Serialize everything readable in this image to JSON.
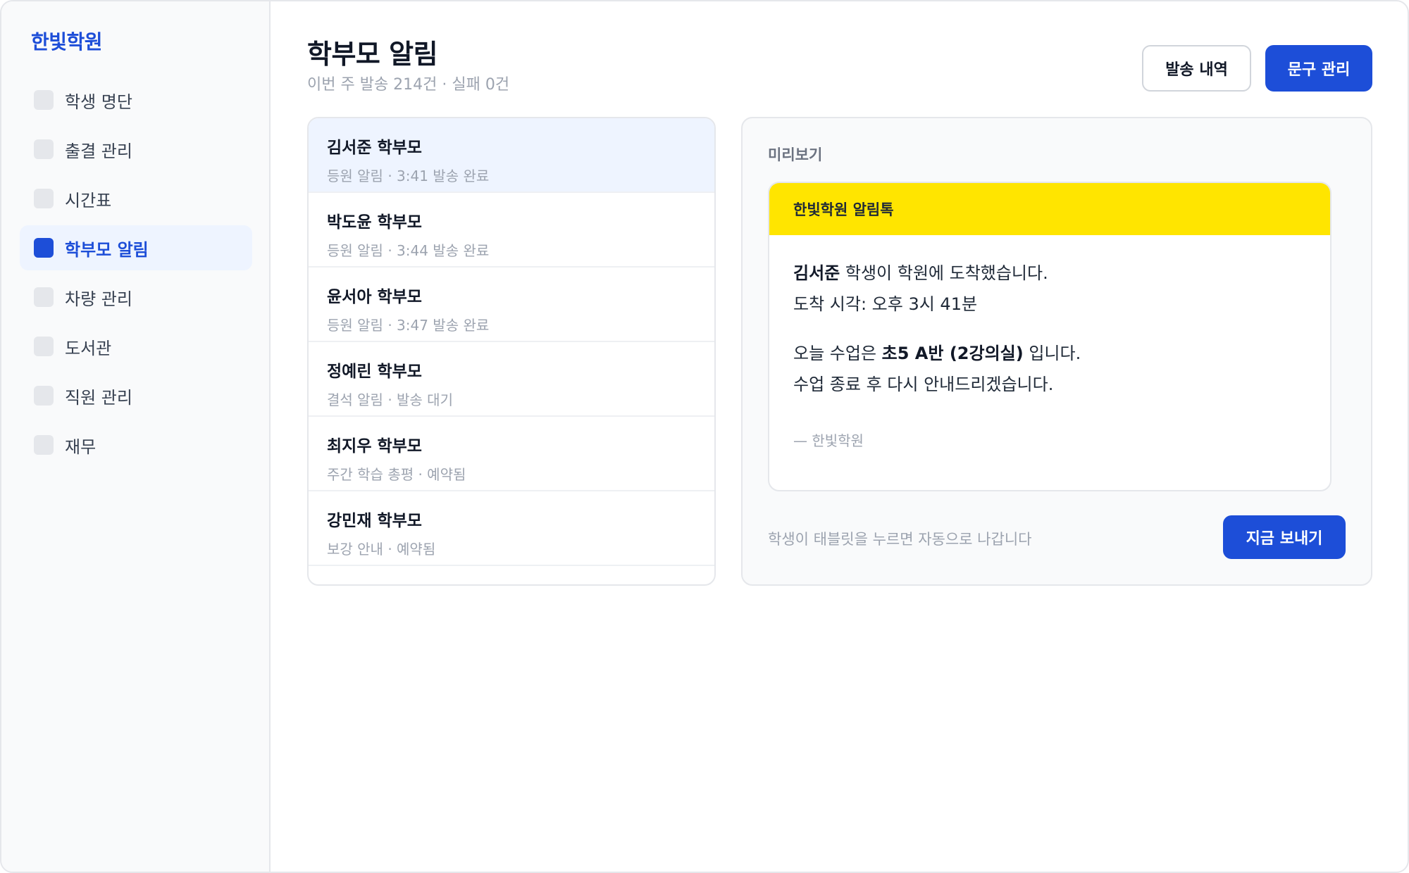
{
  "app": {
    "brand": "한빛학원"
  },
  "sidebar": {
    "items": [
      {
        "label": "학생 명단",
        "icon": "students-icon",
        "active": false
      },
      {
        "label": "출결 관리",
        "icon": "attendance-icon",
        "active": false
      },
      {
        "label": "시간표",
        "icon": "timetable-icon",
        "active": false
      },
      {
        "label": "학부모 알림",
        "icon": "parent-notification-icon",
        "active": true
      },
      {
        "label": "차량 관리",
        "icon": "vehicle-icon",
        "active": false
      },
      {
        "label": "도서관",
        "icon": "library-icon",
        "active": false
      },
      {
        "label": "직원 관리",
        "icon": "staff-icon",
        "active": false
      },
      {
        "label": "재무",
        "icon": "finance-icon",
        "active": false
      }
    ]
  },
  "header": {
    "title": "학부모 알림",
    "subtitle": "이번 주 발송 214건 · 실패 0건",
    "history_button": "발송 내역",
    "templates_button": "문구 관리"
  },
  "recipients": [
    {
      "name": "김서준 학부모",
      "meta": "등원 알림 · 3:41 발송 완료",
      "selected": true
    },
    {
      "name": "박도윤 학부모",
      "meta": "등원 알림 · 3:44 발송 완료",
      "selected": false
    },
    {
      "name": "윤서아 학부모",
      "meta": "등원 알림 · 3:47 발송 완료",
      "selected": false
    },
    {
      "name": "정예린 학부모",
      "meta": "결석 알림 · 발송 대기",
      "selected": false
    },
    {
      "name": "최지우 학부모",
      "meta": "주간 학습 총평 · 예약됨",
      "selected": false
    },
    {
      "name": "강민재 학부모",
      "meta": "보강 안내 · 예약됨",
      "selected": false
    }
  ],
  "preview": {
    "label": "미리보기",
    "message": {
      "header": "한빛학원 알림톡",
      "student_name": "김서준",
      "line1_rest": " 학생이 학원에 도착했습니다.",
      "line2": "도착 시각: 오후 3시 41분",
      "line3_prefix": "오늘 수업은 ",
      "line3_class": "초5 A반 (2강의실)",
      "line3_suffix": " 입니다.",
      "line4": "수업 종료 후 다시 안내드리겠습니다.",
      "signature": "— 한빛학원"
    },
    "footnote": "학생이 태블릿을 누르면 자동으로 나갑니다",
    "send_button": "지금 보내기"
  },
  "colors": {
    "accent": "#1d4ed8",
    "kakao_yellow": "#ffe500",
    "selected_bg": "#eef4ff",
    "muted_text": "#9ca3af"
  }
}
